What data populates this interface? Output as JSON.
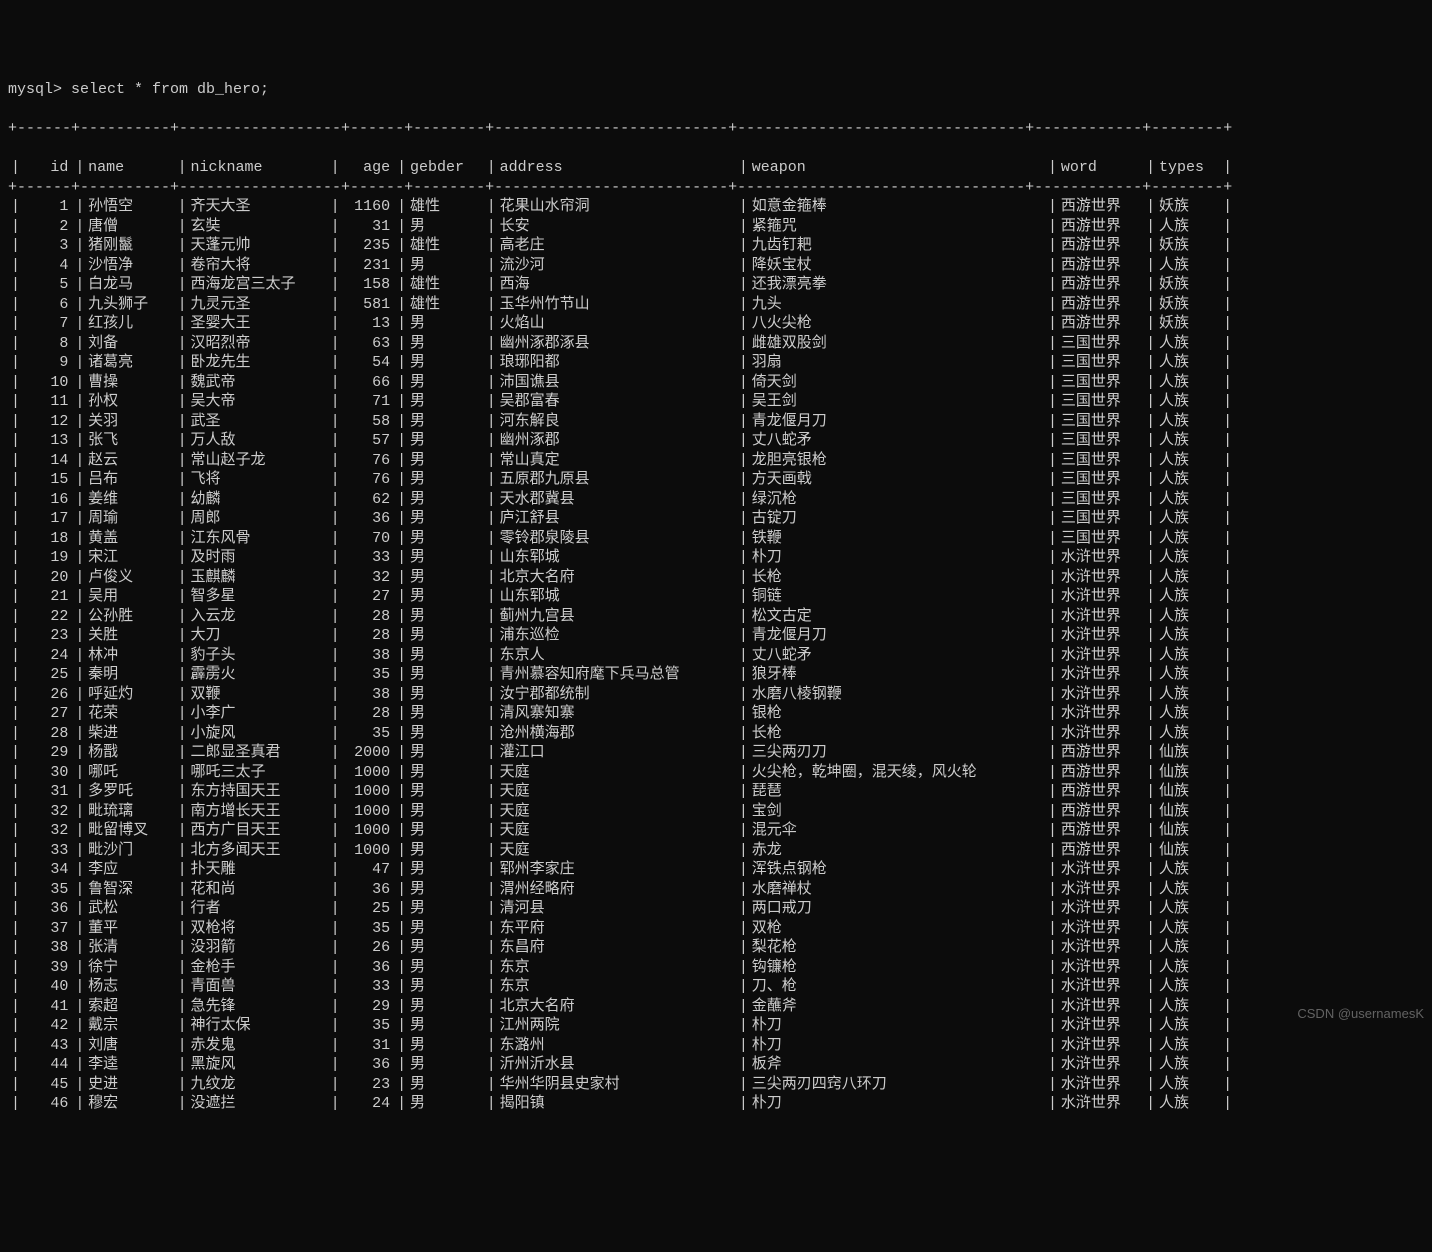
{
  "prompt": "mysql> select * from db_hero;",
  "watermark": "CSDN @usernamesK",
  "columns": [
    "id",
    "name",
    "nickname",
    "age",
    "gebder",
    "address",
    "weapon",
    "word",
    "types"
  ],
  "border_top": "+------+----------+------------------+------+--------+--------------------------+--------------------------------+------------+--------+",
  "rows": [
    {
      "id": 1,
      "name": "孙悟空",
      "nickname": "齐天大圣",
      "age": 1160,
      "gebder": "雄性",
      "address": "花果山水帘洞",
      "weapon": "如意金箍棒",
      "word": "西游世界",
      "types": "妖族"
    },
    {
      "id": 2,
      "name": "唐僧",
      "nickname": "玄奘",
      "age": 31,
      "gebder": "男",
      "address": "长安",
      "weapon": "紧箍咒",
      "word": "西游世界",
      "types": "人族"
    },
    {
      "id": 3,
      "name": "猪刚鬣",
      "nickname": "天蓬元帅",
      "age": 235,
      "gebder": "雄性",
      "address": "高老庄",
      "weapon": "九齿钉耙",
      "word": "西游世界",
      "types": "妖族"
    },
    {
      "id": 4,
      "name": "沙悟净",
      "nickname": "卷帘大将",
      "age": 231,
      "gebder": "男",
      "address": "流沙河",
      "weapon": "降妖宝杖",
      "word": "西游世界",
      "types": "人族"
    },
    {
      "id": 5,
      "name": "白龙马",
      "nickname": "西海龙宫三太子",
      "age": 158,
      "gebder": "雄性",
      "address": "西海",
      "weapon": "还我漂亮拳",
      "word": "西游世界",
      "types": "妖族"
    },
    {
      "id": 6,
      "name": "九头狮子",
      "nickname": "九灵元圣",
      "age": 581,
      "gebder": "雄性",
      "address": "玉华州竹节山",
      "weapon": "九头",
      "word": "西游世界",
      "types": "妖族"
    },
    {
      "id": 7,
      "name": "红孩儿",
      "nickname": "圣婴大王",
      "age": 13,
      "gebder": "男",
      "address": "火焰山",
      "weapon": "八火尖枪",
      "word": "西游世界",
      "types": "妖族"
    },
    {
      "id": 8,
      "name": "刘备",
      "nickname": "汉昭烈帝",
      "age": 63,
      "gebder": "男",
      "address": "幽州涿郡涿县",
      "weapon": "雌雄双股剑",
      "word": "三国世界",
      "types": "人族"
    },
    {
      "id": 9,
      "name": "诸葛亮",
      "nickname": "卧龙先生",
      "age": 54,
      "gebder": "男",
      "address": "琅琊阳都",
      "weapon": "羽扇",
      "word": "三国世界",
      "types": "人族"
    },
    {
      "id": 10,
      "name": "曹操",
      "nickname": "魏武帝",
      "age": 66,
      "gebder": "男",
      "address": "沛国谯县",
      "weapon": "倚天剑",
      "word": "三国世界",
      "types": "人族"
    },
    {
      "id": 11,
      "name": "孙权",
      "nickname": "吴大帝",
      "age": 71,
      "gebder": "男",
      "address": "吴郡富春",
      "weapon": "吴王剑",
      "word": "三国世界",
      "types": "人族"
    },
    {
      "id": 12,
      "name": "关羽",
      "nickname": "武圣",
      "age": 58,
      "gebder": "男",
      "address": "河东解良",
      "weapon": "青龙偃月刀",
      "word": "三国世界",
      "types": "人族"
    },
    {
      "id": 13,
      "name": "张飞",
      "nickname": "万人敌",
      "age": 57,
      "gebder": "男",
      "address": "幽州涿郡",
      "weapon": "丈八蛇矛",
      "word": "三国世界",
      "types": "人族"
    },
    {
      "id": 14,
      "name": "赵云",
      "nickname": "常山赵子龙",
      "age": 76,
      "gebder": "男",
      "address": "常山真定",
      "weapon": "龙胆亮银枪",
      "word": "三国世界",
      "types": "人族"
    },
    {
      "id": 15,
      "name": "吕布",
      "nickname": "飞将",
      "age": 76,
      "gebder": "男",
      "address": "五原郡九原县",
      "weapon": "方天画戟",
      "word": "三国世界",
      "types": "人族"
    },
    {
      "id": 16,
      "name": "姜维",
      "nickname": "幼麟",
      "age": 62,
      "gebder": "男",
      "address": "天水郡冀县",
      "weapon": "绿沉枪",
      "word": "三国世界",
      "types": "人族"
    },
    {
      "id": 17,
      "name": "周瑜",
      "nickname": "周郎",
      "age": 36,
      "gebder": "男",
      "address": "庐江舒县",
      "weapon": "古锭刀",
      "word": "三国世界",
      "types": "人族"
    },
    {
      "id": 18,
      "name": "黄盖",
      "nickname": "江东风骨",
      "age": 70,
      "gebder": "男",
      "address": "零铃郡泉陵县",
      "weapon": "铁鞭",
      "word": "三国世界",
      "types": "人族"
    },
    {
      "id": 19,
      "name": "宋江",
      "nickname": "及时雨",
      "age": 33,
      "gebder": "男",
      "address": "山东郓城",
      "weapon": "朴刀",
      "word": "水浒世界",
      "types": "人族"
    },
    {
      "id": 20,
      "name": "卢俊义",
      "nickname": "玉麒麟",
      "age": 32,
      "gebder": "男",
      "address": "北京大名府",
      "weapon": "长枪",
      "word": "水浒世界",
      "types": "人族"
    },
    {
      "id": 21,
      "name": "吴用",
      "nickname": "智多星",
      "age": 27,
      "gebder": "男",
      "address": "山东郓城",
      "weapon": "铜链",
      "word": "水浒世界",
      "types": "人族"
    },
    {
      "id": 22,
      "name": "公孙胜",
      "nickname": "入云龙",
      "age": 28,
      "gebder": "男",
      "address": "蓟州九宫县",
      "weapon": "松文古定",
      "word": "水浒世界",
      "types": "人族"
    },
    {
      "id": 23,
      "name": "关胜",
      "nickname": "大刀",
      "age": 28,
      "gebder": "男",
      "address": "浦东巡检",
      "weapon": "青龙偃月刀",
      "word": "水浒世界",
      "types": "人族"
    },
    {
      "id": 24,
      "name": "林冲",
      "nickname": "豹子头",
      "age": 38,
      "gebder": "男",
      "address": "东京人",
      "weapon": "丈八蛇矛",
      "word": "水浒世界",
      "types": "人族"
    },
    {
      "id": 25,
      "name": "秦明",
      "nickname": "霹雳火",
      "age": 35,
      "gebder": "男",
      "address": "青州慕容知府麾下兵马总管",
      "weapon": "狼牙棒",
      "word": "水浒世界",
      "types": "人族"
    },
    {
      "id": 26,
      "name": "呼延灼",
      "nickname": "双鞭",
      "age": 38,
      "gebder": "男",
      "address": "汝宁郡都统制",
      "weapon": "水磨八棱钢鞭",
      "word": "水浒世界",
      "types": "人族"
    },
    {
      "id": 27,
      "name": "花荣",
      "nickname": "小李广",
      "age": 28,
      "gebder": "男",
      "address": "清风寨知寨",
      "weapon": "银枪",
      "word": "水浒世界",
      "types": "人族"
    },
    {
      "id": 28,
      "name": "柴进",
      "nickname": "小旋风",
      "age": 35,
      "gebder": "男",
      "address": "沧州横海郡",
      "weapon": "长枪",
      "word": "水浒世界",
      "types": "人族"
    },
    {
      "id": 29,
      "name": "杨戬",
      "nickname": "二郎显圣真君",
      "age": 2000,
      "gebder": "男",
      "address": "灌江口",
      "weapon": "三尖两刃刀",
      "word": "西游世界",
      "types": "仙族"
    },
    {
      "id": 30,
      "name": "哪吒",
      "nickname": "哪吒三太子",
      "age": 1000,
      "gebder": "男",
      "address": "天庭",
      "weapon": "火尖枪，乾坤圈，混天绫，风火轮",
      "word": "西游世界",
      "types": "仙族"
    },
    {
      "id": 31,
      "name": "多罗吒",
      "nickname": "东方持国天王",
      "age": 1000,
      "gebder": "男",
      "address": "天庭",
      "weapon": "琵琶",
      "word": "西游世界",
      "types": "仙族"
    },
    {
      "id": 32,
      "name": "毗琉璃",
      "nickname": "南方增长天王",
      "age": 1000,
      "gebder": "男",
      "address": "天庭",
      "weapon": "宝剑",
      "word": "西游世界",
      "types": "仙族"
    },
    {
      "id": 32,
      "name": "毗留博叉",
      "nickname": "西方广目天王",
      "age": 1000,
      "gebder": "男",
      "address": "天庭",
      "weapon": "混元伞",
      "word": "西游世界",
      "types": "仙族"
    },
    {
      "id": 33,
      "name": "毗沙门",
      "nickname": "北方多闻天王",
      "age": 1000,
      "gebder": "男",
      "address": "天庭",
      "weapon": "赤龙",
      "word": "西游世界",
      "types": "仙族"
    },
    {
      "id": 34,
      "name": "李应",
      "nickname": "扑天雕",
      "age": 47,
      "gebder": "男",
      "address": "郓州李家庄",
      "weapon": "浑铁点钢枪",
      "word": "水浒世界",
      "types": "人族"
    },
    {
      "id": 35,
      "name": "鲁智深",
      "nickname": "花和尚",
      "age": 36,
      "gebder": "男",
      "address": "渭州经略府",
      "weapon": "水磨禅杖",
      "word": "水浒世界",
      "types": "人族"
    },
    {
      "id": 36,
      "name": "武松",
      "nickname": "行者",
      "age": 25,
      "gebder": "男",
      "address": "清河县",
      "weapon": "两口戒刀",
      "word": "水浒世界",
      "types": "人族"
    },
    {
      "id": 37,
      "name": "董平",
      "nickname": "双枪将",
      "age": 35,
      "gebder": "男",
      "address": "东平府",
      "weapon": "双枪",
      "word": "水浒世界",
      "types": "人族"
    },
    {
      "id": 38,
      "name": "张清",
      "nickname": "没羽箭",
      "age": 26,
      "gebder": "男",
      "address": "东昌府",
      "weapon": "梨花枪",
      "word": "水浒世界",
      "types": "人族"
    },
    {
      "id": 39,
      "name": "徐宁",
      "nickname": "金枪手",
      "age": 36,
      "gebder": "男",
      "address": "东京",
      "weapon": "钩镰枪",
      "word": "水浒世界",
      "types": "人族"
    },
    {
      "id": 40,
      "name": "杨志",
      "nickname": "青面兽",
      "age": 33,
      "gebder": "男",
      "address": "东京",
      "weapon": "刀、枪",
      "word": "水浒世界",
      "types": "人族"
    },
    {
      "id": 41,
      "name": "索超",
      "nickname": "急先锋",
      "age": 29,
      "gebder": "男",
      "address": "北京大名府",
      "weapon": "金蘸斧",
      "word": "水浒世界",
      "types": "人族"
    },
    {
      "id": 42,
      "name": "戴宗",
      "nickname": "神行太保",
      "age": 35,
      "gebder": "男",
      "address": "江州两院",
      "weapon": "朴刀",
      "word": "水浒世界",
      "types": "人族"
    },
    {
      "id": 43,
      "name": "刘唐",
      "nickname": "赤发鬼",
      "age": 31,
      "gebder": "男",
      "address": "东潞州",
      "weapon": "朴刀",
      "word": "水浒世界",
      "types": "人族"
    },
    {
      "id": 44,
      "name": "李逵",
      "nickname": "黑旋风",
      "age": 36,
      "gebder": "男",
      "address": "沂州沂水县",
      "weapon": "板斧",
      "word": "水浒世界",
      "types": "人族"
    },
    {
      "id": 45,
      "name": "史进",
      "nickname": "九纹龙",
      "age": 23,
      "gebder": "男",
      "address": "华州华阴县史家村",
      "weapon": "三尖两刃四窍八环刀",
      "word": "水浒世界",
      "types": "人族"
    },
    {
      "id": 46,
      "name": "穆宏",
      "nickname": "没遮拦",
      "age": 24,
      "gebder": "男",
      "address": "揭阳镇",
      "weapon": "朴刀",
      "word": "水浒世界",
      "types": "人族"
    }
  ]
}
